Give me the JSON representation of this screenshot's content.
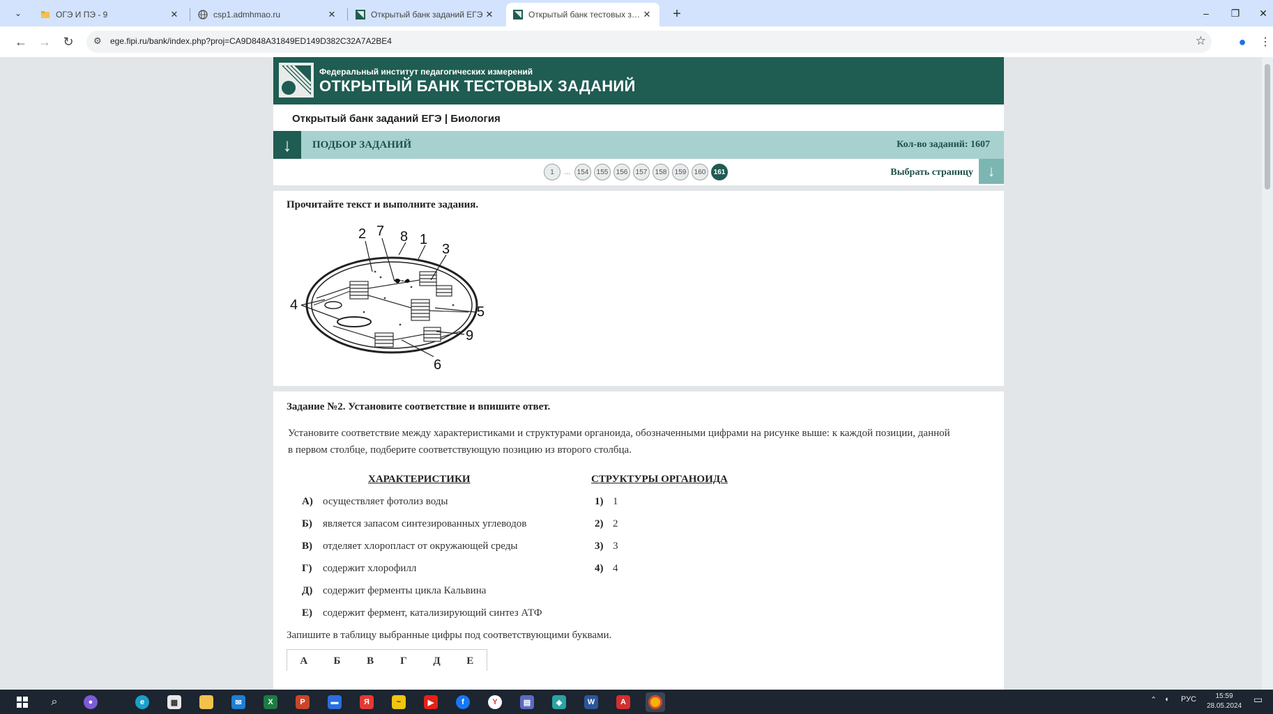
{
  "browser": {
    "tabs": [
      {
        "title": "ОГЭ И ПЭ - 9"
      },
      {
        "title": "csp1.admhmao.ru"
      },
      {
        "title": "Открытый банк заданий ЕГЭ"
      },
      {
        "title": "Открытый банк тестовых зад..."
      }
    ],
    "active_tab": 3,
    "address": "ege.fipi.ru/bank/index.php?proj=CA9D848A31849ED149D382C32A7A2BE4",
    "new_tab_label": "+",
    "window_controls": [
      "–",
      "❐",
      "✕"
    ]
  },
  "site": {
    "org_name": "Федеральный институт педагогических измерений",
    "bank_title": "ОТКРЫТЫЙ БАНК ТЕСТОВЫХ ЗАДАНИЙ",
    "subject": "Открытый банк заданий ЕГЭ | Биология",
    "select_label": "ПОДБОР ЗАДАНИЙ",
    "task_count": "Кол-во заданий: 1607",
    "pager": {
      "first": "1",
      "dots": "...",
      "pages": [
        "154",
        "155",
        "156",
        "157",
        "158",
        "159",
        "160"
      ],
      "current": "161"
    },
    "pick_page": "Выбрать страницу"
  },
  "card1": {
    "heading": "Прочитайте текст и выполните задания.",
    "diagram_labels": [
      "2",
      "7",
      "8",
      "1",
      "3",
      "4",
      "5",
      "9",
      "6"
    ]
  },
  "task": {
    "title": "Задание №2. Установите соответствие и впишите ответ.",
    "text_line1": "Установите соответствие между характеристиками и структурами органоида, обозначенными цифрами на рисунке выше: к каждой позиции, данной",
    "text_line2": "в первом столбце, подберите соответствующую позицию из второго столбца.",
    "left_header": "ХАРАКТЕРИСТИКИ",
    "right_header": "СТРУКТУРЫ ОРГАНОИДА",
    "characteristics": [
      {
        "letter": "А)",
        "text": "осуществляет фотолиз воды"
      },
      {
        "letter": "Б)",
        "text": "является запасом синтезированных углеводов"
      },
      {
        "letter": "В)",
        "text": "отделяет хлоропласт от окружающей среды"
      },
      {
        "letter": "Г)",
        "text": "содержит хлорофилл"
      },
      {
        "letter": "Д)",
        "text": "содержит ферменты цикла Кальвина"
      },
      {
        "letter": "Е)",
        "text": "содержит фермент, катализирующий синтез АТФ"
      }
    ],
    "structures": [
      {
        "num": "1)",
        "text": "1"
      },
      {
        "num": "2)",
        "text": "2"
      },
      {
        "num": "3)",
        "text": "3"
      },
      {
        "num": "4)",
        "text": "4"
      }
    ],
    "instruction": "Запишите в таблицу выбранные цифры под соответствующими буквами.",
    "answer_letters": [
      "А",
      "Б",
      "В",
      "Г",
      "Д",
      "Е"
    ]
  },
  "taskbar": {
    "language": "РУС",
    "time": "15:59",
    "date": "28.05.2024"
  },
  "colors": {
    "banner": "#1f5c52",
    "select_bar": "#a7d1cf",
    "browser_tabbar": "#d3e3fd",
    "taskbar": "#1c2530"
  }
}
